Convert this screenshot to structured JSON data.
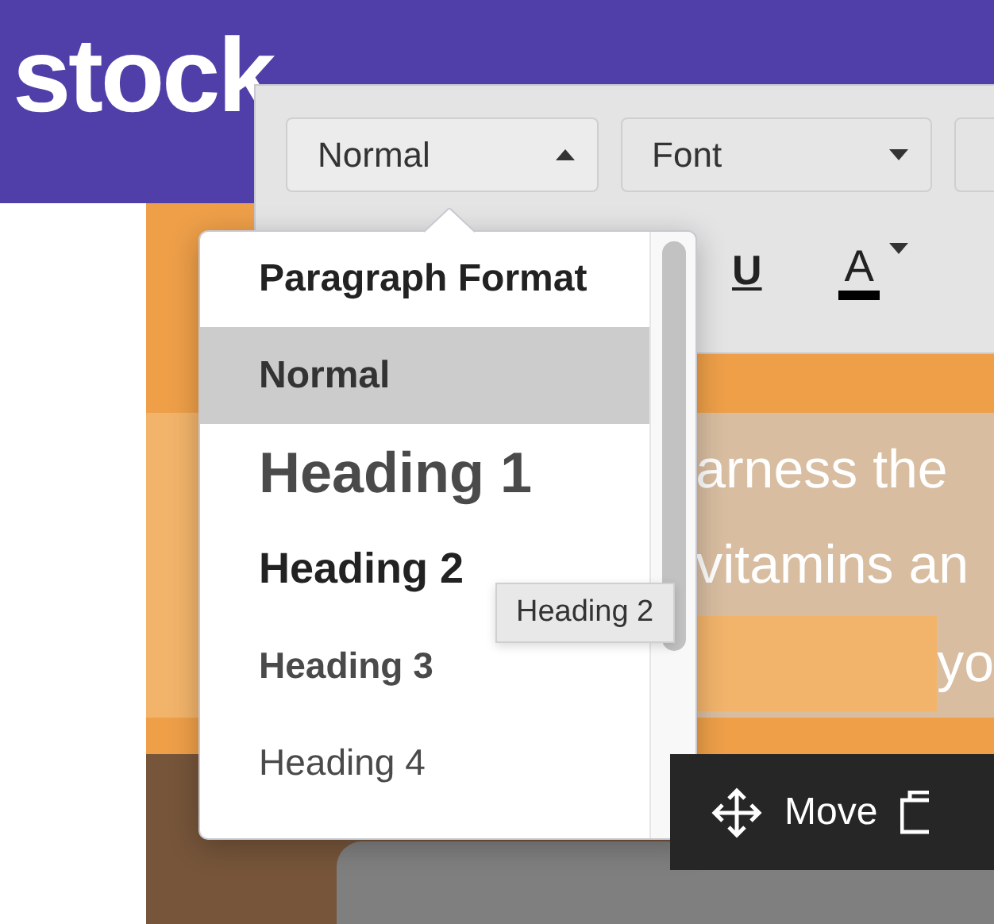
{
  "header": {
    "logo": "stock"
  },
  "toolbar": {
    "dropdowns": [
      {
        "label": "Normal",
        "expanded": true
      },
      {
        "label": "Font",
        "expanded": false
      }
    ],
    "buttons": [
      {
        "kind": "underline",
        "label": "U"
      },
      {
        "kind": "color",
        "label": "A"
      }
    ]
  },
  "format_menu": {
    "title": "Paragraph Format",
    "items": [
      {
        "label": "Normal",
        "kind": "normal",
        "selected": true
      },
      {
        "label": "Heading 1",
        "kind": "h1",
        "selected": false
      },
      {
        "label": "Heading 2",
        "kind": "h2",
        "selected": false
      },
      {
        "label": "Heading 3",
        "kind": "h3",
        "selected": false
      },
      {
        "label": "Heading 4",
        "kind": "h4",
        "selected": false
      }
    ]
  },
  "tooltip": "Heading 2",
  "content": {
    "text_lines": [
      "arness the",
      "vitamins an",
      "yo"
    ]
  },
  "block_toolbar": {
    "buttons": [
      "Move"
    ]
  }
}
